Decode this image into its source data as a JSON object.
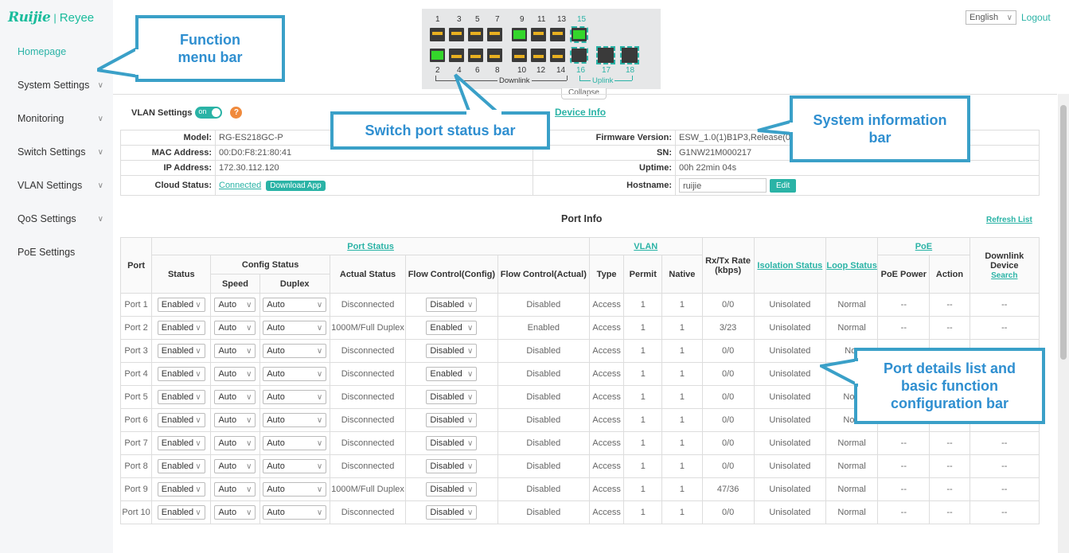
{
  "sidebar": {
    "logo_brand": "Ruijie",
    "logo_sep": "|",
    "logo_sub": "Reyee",
    "items": [
      {
        "label": "Homepage"
      },
      {
        "label": "System Settings"
      },
      {
        "label": "Monitoring"
      },
      {
        "label": "Switch Settings"
      },
      {
        "label": "VLAN Settings"
      },
      {
        "label": "QoS Settings"
      },
      {
        "label": "PoE Settings"
      }
    ]
  },
  "header": {
    "language": "English",
    "logout": "Logout",
    "collapse": "Collapse",
    "downlink_label": "Downlink",
    "uplink_label": "Uplink",
    "top_ports": [
      "1",
      "3",
      "5",
      "7",
      "9",
      "11",
      "13",
      "15"
    ],
    "bottom_ports": [
      "2",
      "4",
      "6",
      "8",
      "10",
      "12",
      "14",
      "16",
      "17",
      "18"
    ]
  },
  "vlan_settings": {
    "label": "VLAN Settings",
    "toggle": "on",
    "help": "?"
  },
  "device_info": {
    "title": "Device Info",
    "model_k": "Model:",
    "model_v": "RG-ES218GC-P",
    "mac_k": "MAC Address:",
    "mac_v": "00:D0:F8:21:80:41",
    "ip_k": "IP Address:",
    "ip_v": "172.30.112.120",
    "cloud_k": "Cloud Status:",
    "cloud_v": "Connected",
    "download_app": "Download App",
    "fw_k": "Firmware Version:",
    "fw_v": "ESW_1.0(1)B1P3,Release(07192314)",
    "sn_k": "SN:",
    "sn_v": "G1NW21M000217",
    "uptime_k": "Uptime:",
    "uptime_v": "00h 22min 04s",
    "host_k": "Hostname:",
    "host_v": "ruijie",
    "edit": "Edit"
  },
  "port_info": {
    "title": "Port Info",
    "refresh": "Refresh List",
    "headers": {
      "port": "Port",
      "port_status": "Port Status",
      "status": "Status",
      "config_status": "Config Status",
      "speed": "Speed",
      "duplex": "Duplex",
      "actual_status": "Actual Status",
      "flow_config": "Flow Control(Config)",
      "flow_actual": "Flow Control(Actual)",
      "vlan": "VLAN",
      "type": "Type",
      "permit": "Permit",
      "native": "Native",
      "rxtx": "Rx/Tx Rate (kbps)",
      "isolation": "Isolation Status",
      "loop": "Loop Status",
      "poe": "PoE",
      "poe_power": "PoE Power",
      "action": "Action",
      "downlink_device": "Downlink Device",
      "search": "Search"
    },
    "rows": [
      {
        "port": "Port 1",
        "status": "Enabled",
        "speed": "Auto",
        "duplex": "Auto",
        "actual": "Disconnected",
        "fc": "Disabled",
        "fa": "Disabled",
        "type": "Access",
        "permit": "1",
        "native": "1",
        "rate": "0/0",
        "iso": "Unisolated",
        "loop": "Normal",
        "poe": "--",
        "action": "--",
        "dev": "--"
      },
      {
        "port": "Port 2",
        "status": "Enabled",
        "speed": "Auto",
        "duplex": "Auto",
        "actual": "1000M/Full Duplex",
        "fc": "Enabled",
        "fa": "Enabled",
        "type": "Access",
        "permit": "1",
        "native": "1",
        "rate": "3/23",
        "iso": "Unisolated",
        "loop": "Normal",
        "poe": "--",
        "action": "--",
        "dev": "--"
      },
      {
        "port": "Port 3",
        "status": "Enabled",
        "speed": "Auto",
        "duplex": "Auto",
        "actual": "Disconnected",
        "fc": "Disabled",
        "fa": "Disabled",
        "type": "Access",
        "permit": "1",
        "native": "1",
        "rate": "0/0",
        "iso": "Unisolated",
        "loop": "Nor",
        "poe": "",
        "action": "",
        "dev": ""
      },
      {
        "port": "Port 4",
        "status": "Enabled",
        "speed": "Auto",
        "duplex": "Auto",
        "actual": "Disconnected",
        "fc": "Enabled",
        "fa": "Disabled",
        "type": "Access",
        "permit": "1",
        "native": "1",
        "rate": "0/0",
        "iso": "Unisolated",
        "loop": "No",
        "poe": "",
        "action": "",
        "dev": ""
      },
      {
        "port": "Port 5",
        "status": "Enabled",
        "speed": "Auto",
        "duplex": "Auto",
        "actual": "Disconnected",
        "fc": "Disabled",
        "fa": "Disabled",
        "type": "Access",
        "permit": "1",
        "native": "1",
        "rate": "0/0",
        "iso": "Unisolated",
        "loop": "Norr",
        "poe": "",
        "action": "",
        "dev": ""
      },
      {
        "port": "Port 6",
        "status": "Enabled",
        "speed": "Auto",
        "duplex": "Auto",
        "actual": "Disconnected",
        "fc": "Disabled",
        "fa": "Disabled",
        "type": "Access",
        "permit": "1",
        "native": "1",
        "rate": "0/0",
        "iso": "Unisolated",
        "loop": "Norr",
        "poe": "",
        "action": "",
        "dev": ""
      },
      {
        "port": "Port 7",
        "status": "Enabled",
        "speed": "Auto",
        "duplex": "Auto",
        "actual": "Disconnected",
        "fc": "Disabled",
        "fa": "Disabled",
        "type": "Access",
        "permit": "1",
        "native": "1",
        "rate": "0/0",
        "iso": "Unisolated",
        "loop": "Normal",
        "poe": "--",
        "action": "--",
        "dev": "--"
      },
      {
        "port": "Port 8",
        "status": "Enabled",
        "speed": "Auto",
        "duplex": "Auto",
        "actual": "Disconnected",
        "fc": "Disabled",
        "fa": "Disabled",
        "type": "Access",
        "permit": "1",
        "native": "1",
        "rate": "0/0",
        "iso": "Unisolated",
        "loop": "Normal",
        "poe": "--",
        "action": "--",
        "dev": "--"
      },
      {
        "port": "Port 9",
        "status": "Enabled",
        "speed": "Auto",
        "duplex": "Auto",
        "actual": "1000M/Full Duplex",
        "fc": "Disabled",
        "fa": "Disabled",
        "type": "Access",
        "permit": "1",
        "native": "1",
        "rate": "47/36",
        "iso": "Unisolated",
        "loop": "Normal",
        "poe": "--",
        "action": "--",
        "dev": "--"
      },
      {
        "port": "Port 10",
        "status": "Enabled",
        "speed": "Auto",
        "duplex": "Auto",
        "actual": "Disconnected",
        "fc": "Disabled",
        "fa": "Disabled",
        "type": "Access",
        "permit": "1",
        "native": "1",
        "rate": "0/0",
        "iso": "Unisolated",
        "loop": "Normal",
        "poe": "--",
        "action": "--",
        "dev": "--"
      }
    ]
  },
  "callouts": {
    "function_menu": "Function menu bar",
    "switch_port": "Switch port status bar",
    "system_info": "System information bar",
    "port_details": "Port details list and basic function configuration bar"
  },
  "colors": {
    "accent": "#2ab3a6",
    "callout_border": "#3aa0c8",
    "callout_text": "#2f8fd0"
  }
}
